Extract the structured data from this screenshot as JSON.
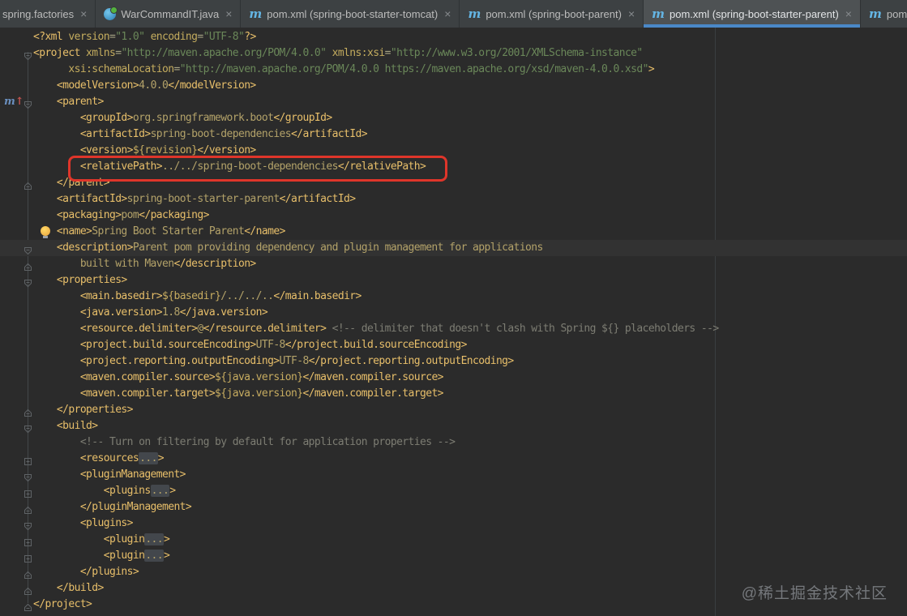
{
  "window_title": "pom.xml (spring-boot-starter-parent)",
  "tabs": [
    {
      "label": "spring.factories",
      "icon": "none",
      "closable": true,
      "active": false
    },
    {
      "label": "WarCommandIT.java",
      "icon": "test",
      "closable": true,
      "active": false
    },
    {
      "label": "pom.xml (spring-boot-starter-tomcat)",
      "icon": "maven",
      "closable": true,
      "active": false
    },
    {
      "label": "pom.xml (spring-boot-parent)",
      "icon": "maven",
      "closable": true,
      "active": false
    },
    {
      "label": "pom.xml (spring-boot-starter-parent)",
      "icon": "maven",
      "closable": true,
      "active": true
    },
    {
      "label": "pom.xm",
      "icon": "maven",
      "closable": false,
      "active": false
    }
  ],
  "icons": {
    "maven_glyph": "m",
    "close_glyph": "×",
    "maven_parent_m": "m",
    "maven_parent_arrow": "↑"
  },
  "colors": {
    "editor_bg": "#2b2b2b",
    "tabbar_bg": "#3d4143",
    "tab_active_bg": "#4e5254",
    "tab_underline": "#4a88c7",
    "maven_icon_blue": "#64b5e4",
    "red_annotation": "#df352a",
    "current_line": "#323232",
    "tokens": {
      "tag": "#e8bf6a",
      "attr": "#c4ac5e",
      "eq": "#a8a585",
      "str": "#6a8759",
      "text": "#b3a269",
      "var": "#c7ac60",
      "comment": "#7d7d73",
      "fold": "#b3a269"
    },
    "gutter_marker": "#5f6366",
    "maven_parent_m_color": "#6a8fbf",
    "maven_parent_arrow_color": "#c75450"
  },
  "editor": {
    "lines": [
      {
        "ind": 0,
        "tokens": [
          [
            "tag",
            "<?xml"
          ],
          [
            "attr",
            " version"
          ],
          [
            "eq",
            "="
          ],
          [
            "str",
            "\"1.0\""
          ],
          [
            "attr",
            " encoding"
          ],
          [
            "eq",
            "="
          ],
          [
            "str",
            "\"UTF-8\""
          ],
          [
            "tag",
            "?>"
          ]
        ]
      },
      {
        "ind": 0,
        "marker": "open",
        "tokens": [
          [
            "tag",
            "<project"
          ],
          [
            "attr",
            " xmlns"
          ],
          [
            "eq",
            "="
          ],
          [
            "str",
            "\"http://maven.apache.org/POM/4.0.0\""
          ],
          [
            "attr",
            " xmlns:xsi"
          ],
          [
            "eq",
            "="
          ],
          [
            "str",
            "\"http://www.w3.org/2001/XMLSchema-instance\""
          ]
        ]
      },
      {
        "ind": 6,
        "tokens": [
          [
            "attr",
            "xsi:schemaLocation"
          ],
          [
            "eq",
            "="
          ],
          [
            "str",
            "\"http://maven.apache.org/POM/4.0.0 https://maven.apache.org/xsd/maven-4.0.0.xsd\""
          ],
          [
            "tag",
            ">"
          ]
        ]
      },
      {
        "ind": 4,
        "tokens": [
          [
            "tag",
            "<modelVersion>"
          ],
          [
            "text",
            "4.0.0"
          ],
          [
            "tag",
            "</modelVersion>"
          ]
        ]
      },
      {
        "ind": 4,
        "marker": "open",
        "icon": "maven-parent",
        "tokens": [
          [
            "tag",
            "<parent>"
          ]
        ]
      },
      {
        "ind": 8,
        "tokens": [
          [
            "tag",
            "<groupId>"
          ],
          [
            "text",
            "org.springframework.boot"
          ],
          [
            "tag",
            "</groupId>"
          ]
        ]
      },
      {
        "ind": 8,
        "tokens": [
          [
            "tag",
            "<artifactId>"
          ],
          [
            "text",
            "spring-boot-dependencies"
          ],
          [
            "tag",
            "</artifactId>"
          ]
        ]
      },
      {
        "ind": 8,
        "tokens": [
          [
            "tag",
            "<version>"
          ],
          [
            "var",
            "${revision}"
          ],
          [
            "tag",
            "</version>"
          ]
        ]
      },
      {
        "ind": 8,
        "redbox": true,
        "tokens": [
          [
            "tag",
            "<relativePath>"
          ],
          [
            "text",
            "../../spring-boot-dependencies"
          ],
          [
            "tag",
            "</relativePath>"
          ]
        ]
      },
      {
        "ind": 4,
        "marker": "close",
        "tokens": [
          [
            "tag",
            "</parent>"
          ]
        ]
      },
      {
        "ind": 4,
        "tokens": [
          [
            "tag",
            "<artifactId>"
          ],
          [
            "text",
            "spring-boot-starter-parent"
          ],
          [
            "tag",
            "</artifactId>"
          ]
        ]
      },
      {
        "ind": 4,
        "tokens": [
          [
            "tag",
            "<packaging>"
          ],
          [
            "text",
            "pom"
          ],
          [
            "tag",
            "</packaging>"
          ]
        ]
      },
      {
        "ind": 4,
        "icon": "bulb",
        "tokens": [
          [
            "tag",
            "<name>"
          ],
          [
            "text",
            "Spring Boot Starter Parent"
          ],
          [
            "tag",
            "</name>"
          ]
        ]
      },
      {
        "ind": 4,
        "marker": "open",
        "hl": true,
        "tokens": [
          [
            "tag",
            "<description>"
          ],
          [
            "text",
            "Parent pom providing dependency and plugin management for applications"
          ]
        ]
      },
      {
        "ind": 8,
        "marker": "close",
        "tokens": [
          [
            "text",
            "built with Maven"
          ],
          [
            "tag",
            "</description>"
          ]
        ]
      },
      {
        "ind": 4,
        "marker": "open",
        "tokens": [
          [
            "tag",
            "<properties>"
          ]
        ]
      },
      {
        "ind": 8,
        "tokens": [
          [
            "tag",
            "<main.basedir>"
          ],
          [
            "var",
            "${basedir}"
          ],
          [
            "text",
            "/../../.."
          ],
          [
            "tag",
            "</main.basedir>"
          ]
        ]
      },
      {
        "ind": 8,
        "tokens": [
          [
            "tag",
            "<java.version>"
          ],
          [
            "text",
            "1.8"
          ],
          [
            "tag",
            "</java.version>"
          ]
        ]
      },
      {
        "ind": 8,
        "tokens": [
          [
            "tag",
            "<resource.delimiter>"
          ],
          [
            "text",
            "@"
          ],
          [
            "tag",
            "</resource.delimiter>"
          ],
          [
            "comment",
            " <!-- delimiter that doesn't clash with Spring ${} placeholders -->"
          ]
        ]
      },
      {
        "ind": 8,
        "tokens": [
          [
            "tag",
            "<project.build.sourceEncoding>"
          ],
          [
            "text",
            "UTF-8"
          ],
          [
            "tag",
            "</project.build.sourceEncoding>"
          ]
        ]
      },
      {
        "ind": 8,
        "tokens": [
          [
            "tag",
            "<project.reporting.outputEncoding>"
          ],
          [
            "text",
            "UTF-8"
          ],
          [
            "tag",
            "</project.reporting.outputEncoding>"
          ]
        ]
      },
      {
        "ind": 8,
        "tokens": [
          [
            "tag",
            "<maven.compiler.source>"
          ],
          [
            "var",
            "${java.version}"
          ],
          [
            "tag",
            "</maven.compiler.source>"
          ]
        ]
      },
      {
        "ind": 8,
        "tokens": [
          [
            "tag",
            "<maven.compiler.target>"
          ],
          [
            "var",
            "${java.version}"
          ],
          [
            "tag",
            "</maven.compiler.target>"
          ]
        ]
      },
      {
        "ind": 4,
        "marker": "close",
        "tokens": [
          [
            "tag",
            "</properties>"
          ]
        ]
      },
      {
        "ind": 4,
        "marker": "open",
        "tokens": [
          [
            "tag",
            "<build>"
          ]
        ]
      },
      {
        "ind": 8,
        "tokens": [
          [
            "comment",
            "<!-- Turn on filtering by default for application properties -->"
          ]
        ]
      },
      {
        "ind": 8,
        "marker": "plus",
        "tokens": [
          [
            "tag",
            "<resources"
          ],
          [
            "fold",
            "..."
          ],
          [
            "tag",
            ">"
          ]
        ]
      },
      {
        "ind": 8,
        "marker": "open",
        "tokens": [
          [
            "tag",
            "<pluginManagement>"
          ]
        ]
      },
      {
        "ind": 12,
        "marker": "plus",
        "tokens": [
          [
            "tag",
            "<plugins"
          ],
          [
            "fold",
            "..."
          ],
          [
            "tag",
            ">"
          ]
        ]
      },
      {
        "ind": 8,
        "marker": "close",
        "tokens": [
          [
            "tag",
            "</pluginManagement>"
          ]
        ]
      },
      {
        "ind": 8,
        "marker": "open",
        "tokens": [
          [
            "tag",
            "<plugins>"
          ]
        ]
      },
      {
        "ind": 12,
        "marker": "plus",
        "tokens": [
          [
            "tag",
            "<plugin"
          ],
          [
            "fold",
            "..."
          ],
          [
            "tag",
            ">"
          ]
        ]
      },
      {
        "ind": 12,
        "marker": "plus",
        "tokens": [
          [
            "tag",
            "<plugin"
          ],
          [
            "fold",
            "..."
          ],
          [
            "tag",
            ">"
          ]
        ]
      },
      {
        "ind": 8,
        "marker": "close",
        "tokens": [
          [
            "tag",
            "</plugins>"
          ]
        ]
      },
      {
        "ind": 4,
        "marker": "close",
        "tokens": [
          [
            "tag",
            "</build>"
          ]
        ]
      },
      {
        "ind": 0,
        "marker": "close",
        "tokens": [
          [
            "tag",
            "</project>"
          ]
        ]
      }
    ]
  },
  "watermark": "@稀土掘金技术社区"
}
